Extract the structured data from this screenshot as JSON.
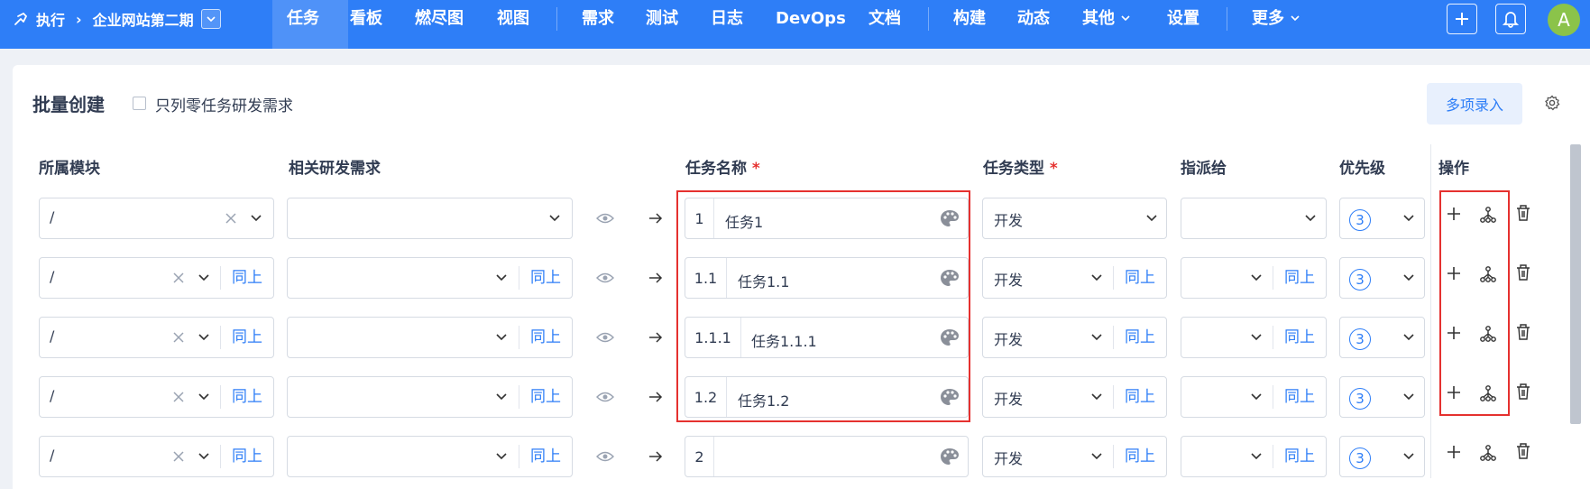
{
  "header": {
    "breadcrumb": {
      "root": "执行",
      "project": "企业网站第二期"
    },
    "nav": [
      {
        "label": "任务",
        "active": true
      },
      {
        "label": "看板"
      },
      {
        "label": "燃尽图"
      },
      {
        "label": "视图"
      },
      {
        "label": "需求"
      },
      {
        "label": "测试"
      },
      {
        "label": "日志"
      },
      {
        "label": "DevOps"
      },
      {
        "label": "文档"
      },
      {
        "label": "构建"
      },
      {
        "label": "动态"
      },
      {
        "label": "其他",
        "dropdown": true
      },
      {
        "label": "设置"
      },
      {
        "label": "更多",
        "dropdown": true
      }
    ],
    "avatar": "A",
    "colors": {
      "bar": "#2e7ef7",
      "accent": "#2e7ef7",
      "danger": "#e5312f"
    }
  },
  "page": {
    "title": "批量创建",
    "checkbox_label": "只列零任务研发需求",
    "multi_entry_button": "多项录入"
  },
  "columns": {
    "module": "所属模块",
    "story": "相关研发需求",
    "name": "任务名称",
    "type": "任务类型",
    "assign": "指派给",
    "priority": "优先级",
    "actions": "操作"
  },
  "same_label": "同上",
  "rows": [
    {
      "module": "/",
      "num": "1",
      "name": "任务1",
      "type": "开发",
      "priority": "3"
    },
    {
      "module": "/",
      "num": "1.1",
      "name": "任务1.1",
      "type": "开发",
      "priority": "3"
    },
    {
      "module": "/",
      "num": "1.1.1",
      "name": "任务1.1.1",
      "type": "开发",
      "priority": "3"
    },
    {
      "module": "/",
      "num": "1.2",
      "name": "任务1.2",
      "type": "开发",
      "priority": "3"
    },
    {
      "module": "/",
      "num": "2",
      "name": "",
      "type": "开发",
      "priority": "3"
    }
  ]
}
